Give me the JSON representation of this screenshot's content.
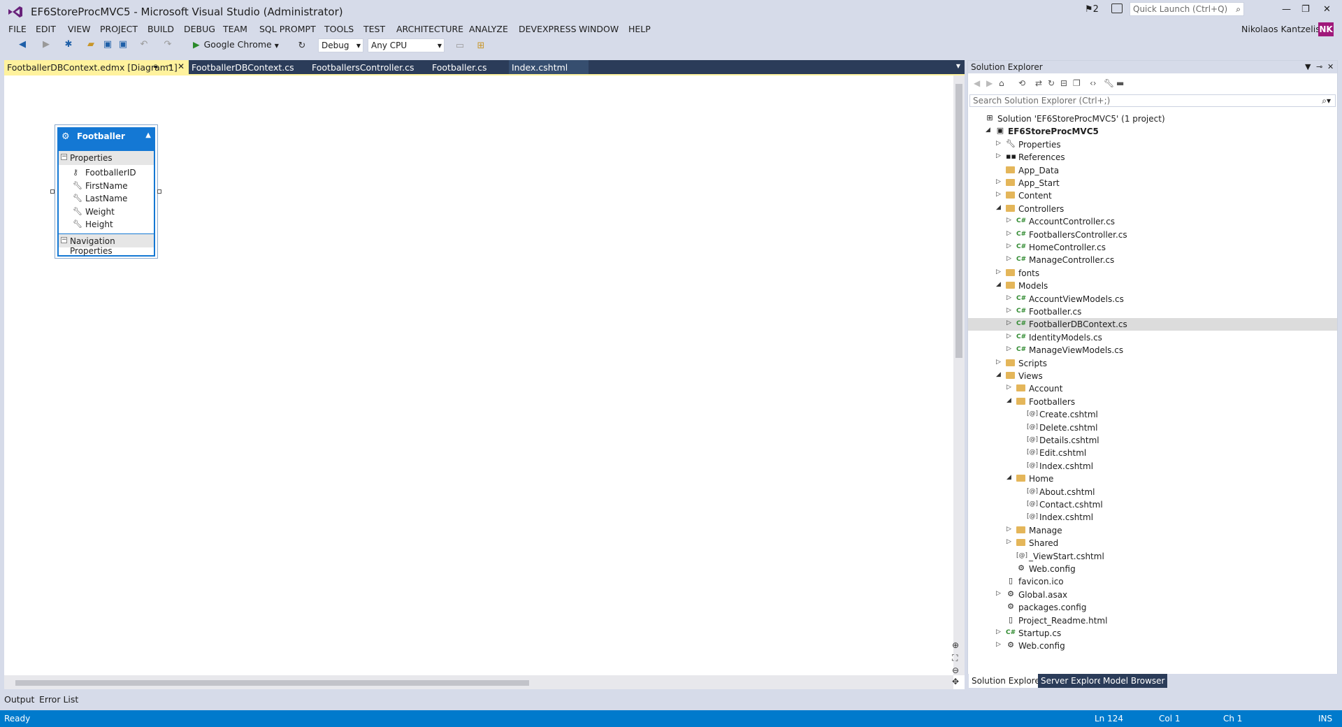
{
  "window": {
    "title": "EF6StoreProcMVC5 - Microsoft Visual Studio (Administrator)",
    "notifications": "2",
    "quick_launch_placeholder": "Quick Launch (Ctrl+Q)",
    "user": "Nikolaos Kantzelis",
    "avatar": "NK"
  },
  "menu": [
    "FILE",
    "EDIT",
    "VIEW",
    "PROJECT",
    "BUILD",
    "DEBUG",
    "TEAM",
    "SQL PROMPT",
    "TOOLS",
    "TEST",
    "ARCHITECTURE",
    "ANALYZE",
    "DEVEXPRESS",
    "WINDOW",
    "HELP"
  ],
  "toolbar": {
    "run_target": "Google Chrome",
    "configuration": "Debug",
    "platform": "Any CPU"
  },
  "tabs": [
    {
      "label": "FootballerDBContext.edmx [Diagram1]",
      "active": true
    },
    {
      "label": "FootballerDBContext.cs",
      "active": false
    },
    {
      "label": "FootballersController.cs",
      "active": false
    },
    {
      "label": "Footballer.cs",
      "active": false
    },
    {
      "label": "Index.cshtml",
      "active": false
    }
  ],
  "entity": {
    "name": "Footballer",
    "properties_header": "Properties",
    "properties": [
      "FootballerID",
      "FirstName",
      "LastName",
      "Weight",
      "Height"
    ],
    "nav_header": "Navigation Properties"
  },
  "bottom_tabs": [
    "Output",
    "Error List"
  ],
  "status": {
    "state": "Ready",
    "ln": "Ln 124",
    "col": "Col 1",
    "ch": "Ch 1",
    "mode": "INS"
  },
  "solution_explorer": {
    "title": "Solution Explorer",
    "search_placeholder": "Search Solution Explorer (Ctrl+;)",
    "tree": [
      {
        "label": "Solution 'EF6StoreProcMVC5' (1 project)",
        "type": "sol",
        "exp": ""
      },
      {
        "label": "EF6StoreProcMVC5",
        "type": "proj",
        "exp": "open",
        "bold": true
      },
      {
        "label": "Properties",
        "type": "wrench",
        "exp": "closed"
      },
      {
        "label": "References",
        "type": "ref",
        "exp": "closed"
      },
      {
        "label": "App_Data",
        "type": "folder",
        "exp": ""
      },
      {
        "label": "App_Start",
        "type": "folder",
        "exp": "closed"
      },
      {
        "label": "Content",
        "type": "folder",
        "exp": "closed"
      },
      {
        "label": "Controllers",
        "type": "folder",
        "exp": "open"
      },
      {
        "label": "AccountController.cs",
        "type": "cs",
        "exp": "closed"
      },
      {
        "label": "FootballersController.cs",
        "type": "cs",
        "exp": "closed"
      },
      {
        "label": "HomeController.cs",
        "type": "cs",
        "exp": "closed"
      },
      {
        "label": "ManageController.cs",
        "type": "cs",
        "exp": "closed"
      },
      {
        "label": "fonts",
        "type": "folder",
        "exp": "closed"
      },
      {
        "label": "Models",
        "type": "folder",
        "exp": "open"
      },
      {
        "label": "AccountViewModels.cs",
        "type": "cs",
        "exp": "closed"
      },
      {
        "label": "Footballer.cs",
        "type": "cs",
        "exp": "closed"
      },
      {
        "label": "FootballerDBContext.cs",
        "type": "cs",
        "exp": "closed",
        "selected": true
      },
      {
        "label": "IdentityModels.cs",
        "type": "cs",
        "exp": "closed"
      },
      {
        "label": "ManageViewModels.cs",
        "type": "cs",
        "exp": "closed"
      },
      {
        "label": "Scripts",
        "type": "folder",
        "exp": "closed"
      },
      {
        "label": "Views",
        "type": "folder",
        "exp": "open"
      },
      {
        "label": "Account",
        "type": "folder",
        "exp": "closed"
      },
      {
        "label": "Footballers",
        "type": "folder",
        "exp": "open"
      },
      {
        "label": "Create.cshtml",
        "type": "cshtml",
        "exp": ""
      },
      {
        "label": "Delete.cshtml",
        "type": "cshtml",
        "exp": ""
      },
      {
        "label": "Details.cshtml",
        "type": "cshtml",
        "exp": ""
      },
      {
        "label": "Edit.cshtml",
        "type": "cshtml",
        "exp": ""
      },
      {
        "label": "Index.cshtml",
        "type": "cshtml",
        "exp": ""
      },
      {
        "label": "Home",
        "type": "folder",
        "exp": "open"
      },
      {
        "label": "About.cshtml",
        "type": "cshtml",
        "exp": ""
      },
      {
        "label": "Contact.cshtml",
        "type": "cshtml",
        "exp": ""
      },
      {
        "label": "Index.cshtml",
        "type": "cshtml",
        "exp": ""
      },
      {
        "label": "Manage",
        "type": "folder",
        "exp": "closed"
      },
      {
        "label": "Shared",
        "type": "folder",
        "exp": "closed"
      },
      {
        "label": "_ViewStart.cshtml",
        "type": "cshtml",
        "exp": ""
      },
      {
        "label": "Web.config",
        "type": "config",
        "exp": ""
      },
      {
        "label": "favicon.ico",
        "type": "file",
        "exp": ""
      },
      {
        "label": "Global.asax",
        "type": "config",
        "exp": "closed"
      },
      {
        "label": "packages.config",
        "type": "config",
        "exp": ""
      },
      {
        "label": "Project_Readme.html",
        "type": "file",
        "exp": ""
      },
      {
        "label": "Startup.cs",
        "type": "cs",
        "exp": "closed"
      },
      {
        "label": "Web.config",
        "type": "config",
        "exp": "closed"
      }
    ],
    "tabs": [
      {
        "label": "Solution Explorer",
        "active": true
      },
      {
        "label": "Server Explorer",
        "active": false
      },
      {
        "label": "Model Browser",
        "active": false
      }
    ]
  }
}
